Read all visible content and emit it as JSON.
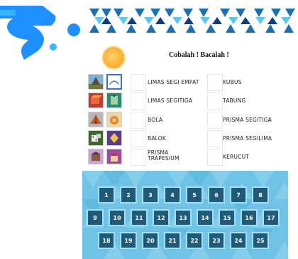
{
  "header": {
    "title": "Cobalah ! Bacalah !"
  },
  "colors": {
    "panel": "#6ec3e6",
    "tile": "#1f5b78",
    "tile_border": "#a9dff2",
    "accent_blue": "#1e90ff",
    "sun": "#ffb238"
  },
  "pairs": [
    {
      "icon": "pyramid-image",
      "left_label": "LIMAS SEGI EMPAT",
      "right_label": "KUBUS"
    },
    {
      "icon": "box-image",
      "left_label": "LIMAS SEGITIGA",
      "right_label": "TABUNG"
    },
    {
      "icon": "tent-image",
      "left_label": "BOLA",
      "right_label": "PRISMA SEGITIGA"
    },
    {
      "icon": "dice-image",
      "left_label": "BALOK",
      "right_label": "PRISMA SEGILIMA"
    },
    {
      "icon": "building-image",
      "left_label": "PRISMA\nTRAPESIUM",
      "right_label": "KERUCUT"
    }
  ],
  "number_tiles": [
    [
      "1",
      "2",
      "3",
      "4",
      "5",
      "6",
      "7",
      "8"
    ],
    [
      "9",
      "10",
      "11",
      "12",
      "13",
      "14",
      "15",
      "16",
      "17"
    ],
    [
      "18",
      "19",
      "20",
      "21",
      "22",
      "23",
      "24",
      "25"
    ]
  ]
}
